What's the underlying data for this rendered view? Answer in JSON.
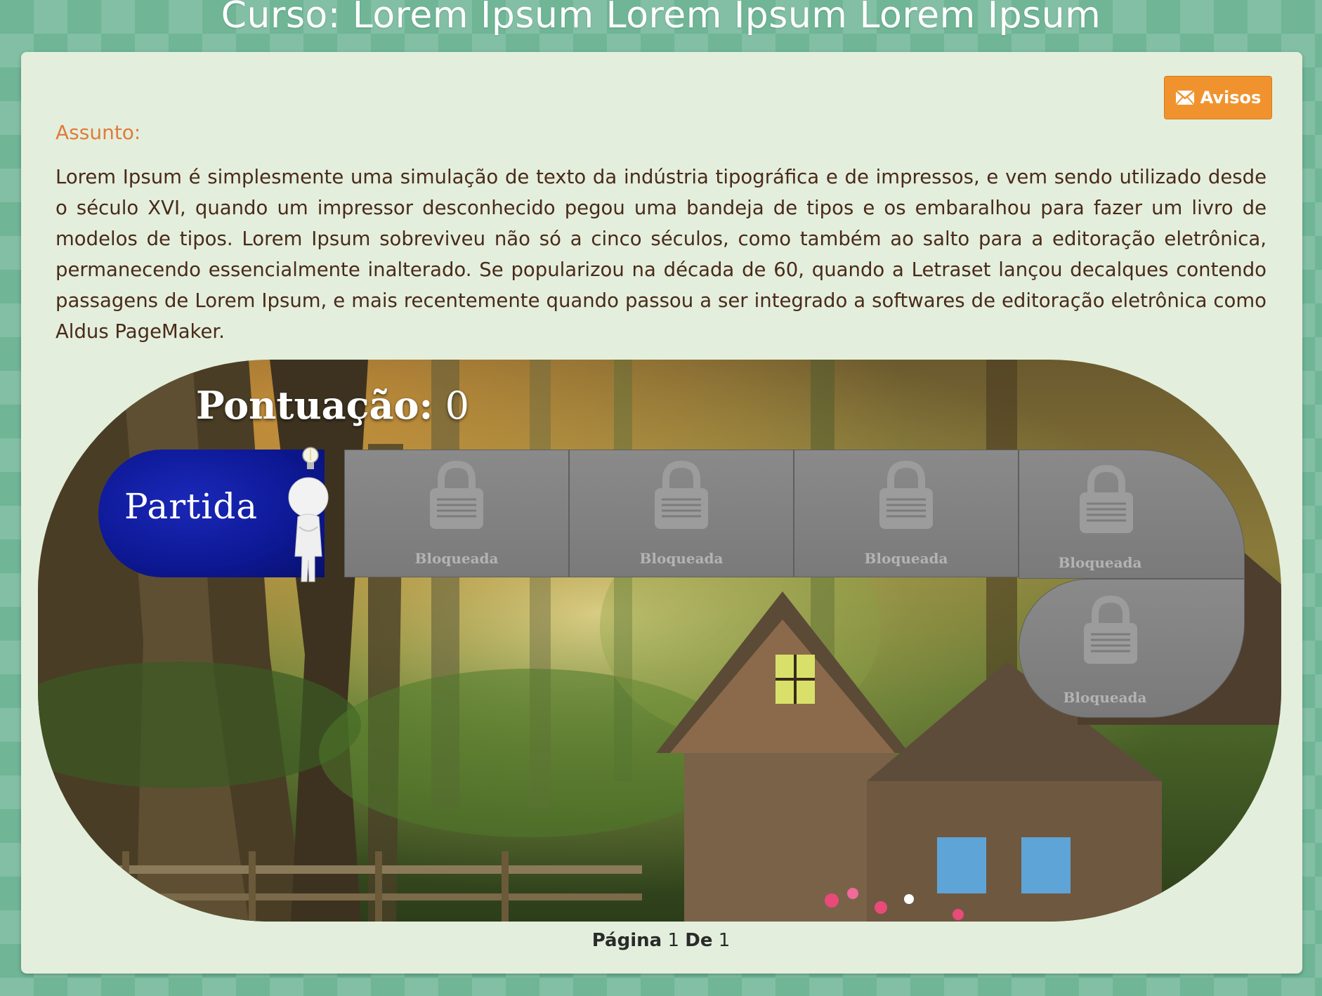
{
  "header": {
    "title": "Curso: Lorem Ipsum Lorem Ipsum Lorem Ipsum"
  },
  "toolbar": {
    "avisos_label": "Avisos",
    "avisos_icon": "envelope-icon"
  },
  "content": {
    "subject_label": "Assunto:",
    "subject_text": "Lorem Ipsum é simplesmente uma simulação de texto da indústria tipográfica e de impressos, e vem sendo utilizado desde o século XVI, quando um impressor desconhecido pegou uma bandeja de tipos e os embaralhou para fazer um livro de modelos de tipos. Lorem Ipsum sobreviveu não só a cinco séculos, como também ao salto para a editoração eletrônica, permanecendo essencialmente inalterado. Se popularizou na década de 60, quando a Letraset lançou decalques contendo passagens de Lorem Ipsum, e mais recentemente quando passou a ser integrado a softwares de editoração eletrônica como Aldus PageMaker."
  },
  "game": {
    "score_label": "Pontuação:",
    "score_value": "0",
    "start_label": "Partida",
    "stages": [
      {
        "label": "Bloqueada",
        "icon": "lock-icon"
      },
      {
        "label": "Bloqueada",
        "icon": "lock-icon"
      },
      {
        "label": "Bloqueada",
        "icon": "lock-icon"
      },
      {
        "label": "Bloqueada",
        "icon": "lock-icon"
      },
      {
        "label": "Bloqueada",
        "icon": "lock-icon"
      }
    ]
  },
  "pagination": {
    "page_label": "Página",
    "current": "1",
    "of_label": "De",
    "total": "1"
  },
  "colors": {
    "accent": "#f0932f",
    "start": "#0d1894",
    "tile": "#808080",
    "label": "#e07b3c"
  }
}
